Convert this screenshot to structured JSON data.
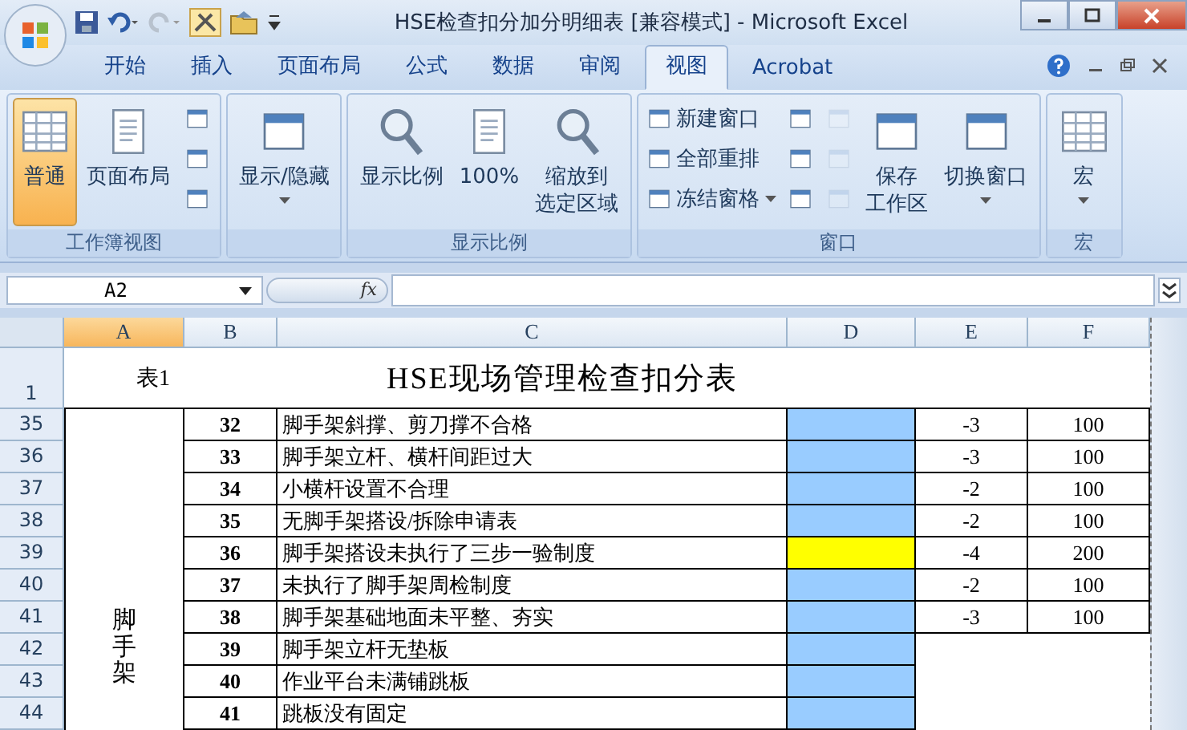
{
  "window": {
    "title": "HSE检查扣分加分明细表  [兼容模式] - Microsoft Excel"
  },
  "tabs": [
    {
      "label": "开始",
      "selected": false
    },
    {
      "label": "插入",
      "selected": false
    },
    {
      "label": "页面布局",
      "selected": false
    },
    {
      "label": "公式",
      "selected": false
    },
    {
      "label": "数据",
      "selected": false
    },
    {
      "label": "审阅",
      "selected": false
    },
    {
      "label": "视图",
      "selected": true
    },
    {
      "label": "Acrobat",
      "selected": false
    }
  ],
  "ribbon": {
    "groups": [
      {
        "label": "工作簿视图",
        "items": [
          {
            "kind": "large",
            "label": "普通",
            "selected": true
          },
          {
            "kind": "large",
            "label": "页面布局",
            "selected": false
          },
          {
            "kind": "stack",
            "items": [
              {
                "kind": "icon",
                "selected": false
              },
              {
                "kind": "icon",
                "selected": false
              },
              {
                "kind": "icon",
                "selected": false
              }
            ]
          }
        ]
      },
      {
        "items": [
          {
            "kind": "large",
            "label": "显示/隐藏",
            "dropdown": true
          }
        ]
      },
      {
        "label": "显示比例",
        "items": [
          {
            "kind": "large",
            "label": "显示比例"
          },
          {
            "kind": "large",
            "label": "100%"
          },
          {
            "kind": "large",
            "lines": [
              "缩放到",
              "选定区域"
            ]
          }
        ]
      },
      {
        "label": "窗口",
        "items": [
          {
            "kind": "stack",
            "items": [
              {
                "kind": "small",
                "label": "新建窗口"
              },
              {
                "kind": "small",
                "label": "全部重排"
              },
              {
                "kind": "small",
                "label": "冻结窗格",
                "dropdown": true
              }
            ]
          },
          {
            "kind": "stack",
            "items": [
              {
                "kind": "icon"
              },
              {
                "kind": "icon"
              },
              {
                "kind": "icon"
              }
            ]
          },
          {
            "kind": "stack",
            "items": [
              {
                "kind": "icon",
                "disabled": true
              },
              {
                "kind": "icon",
                "disabled": true
              },
              {
                "kind": "icon",
                "disabled": true
              }
            ]
          },
          {
            "kind": "large",
            "lines": [
              "保存",
              "工作区"
            ]
          },
          {
            "kind": "large",
            "label": "切换窗口",
            "dropdown": true
          }
        ]
      },
      {
        "label": "宏",
        "items": [
          {
            "kind": "large",
            "label": "宏",
            "dropdown": true
          }
        ]
      }
    ]
  },
  "formula_bar": {
    "name_box": "A2",
    "function_label": "fx"
  },
  "sheet": {
    "columns": [
      {
        "label": "A",
        "selected": true
      },
      {
        "label": "B",
        "selected": false
      },
      {
        "label": "C",
        "selected": false
      },
      {
        "label": "D",
        "selected": false
      },
      {
        "label": "E",
        "selected": false
      },
      {
        "label": "F",
        "selected": false
      }
    ],
    "title_row": {
      "row": "1",
      "label": "表1",
      "title": "HSE现场管理检查扣分表"
    },
    "category": "脚手架",
    "rows": [
      {
        "row": "35",
        "no": "32",
        "item": "脚手架斜撑、剪刀撑不合格",
        "color": "#99ccff",
        "deduction": "-3",
        "score": "100"
      },
      {
        "row": "36",
        "no": "33",
        "item": "脚手架立杆、横杆间距过大",
        "color": "#99ccff",
        "deduction": "-3",
        "score": "100"
      },
      {
        "row": "37",
        "no": "34",
        "item": "小横杆设置不合理",
        "color": "#99ccff",
        "deduction": "-2",
        "score": "100"
      },
      {
        "row": "38",
        "no": "35",
        "item": "无脚手架搭设/拆除申请表",
        "color": "#99ccff",
        "deduction": "-2",
        "score": "100"
      },
      {
        "row": "39",
        "no": "36",
        "item": "脚手架搭设未执行了三步一验制度",
        "color": "#ffff00",
        "deduction": "-4",
        "score": "200"
      },
      {
        "row": "40",
        "no": "37",
        "item": "未执行了脚手架周检制度",
        "color": "#99ccff",
        "deduction": "-2",
        "score": "100"
      },
      {
        "row": "41",
        "no": "38",
        "item": "脚手架基础地面未平整、夯实",
        "color": "#99ccff",
        "deduction": "-3",
        "score": "100"
      },
      {
        "row": "42",
        "no": "39",
        "item": "脚手架立杆无垫板",
        "color": "#99ccff"
      },
      {
        "row": "43",
        "no": "40",
        "item": "作业平台未满铺跳板",
        "color": "#99ccff"
      },
      {
        "row": "44",
        "no": "41",
        "item": "跳板没有固定",
        "color": "#99ccff"
      }
    ]
  }
}
